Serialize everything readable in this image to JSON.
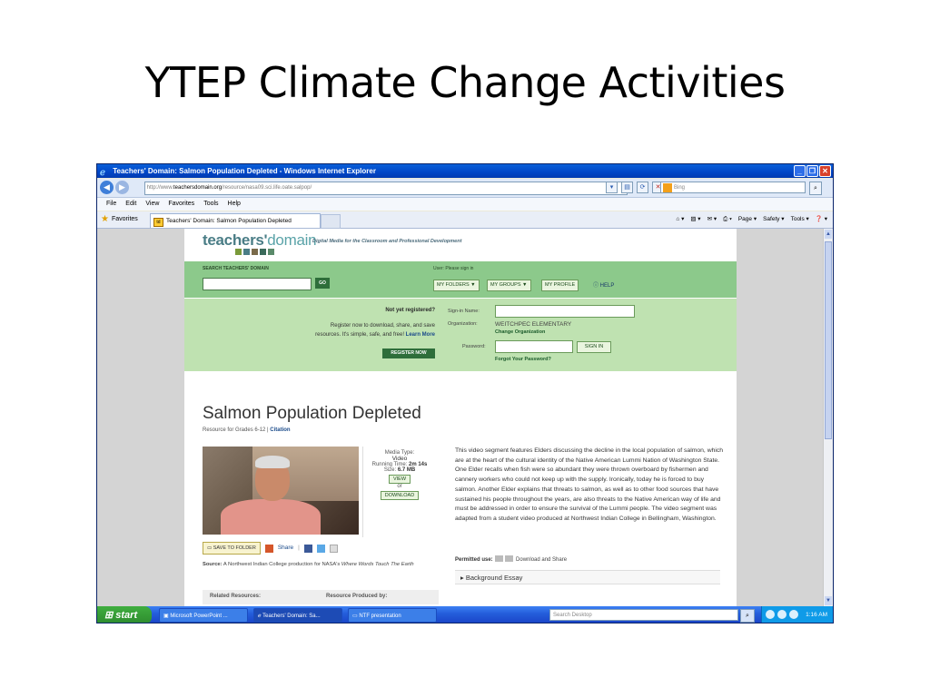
{
  "slide": {
    "title": "YTEP Climate Change Activities"
  },
  "browser": {
    "window_title": "Teachers' Domain: Salmon Population Depleted - Windows Internet Explorer",
    "address": {
      "prefix": "http://www.",
      "domain": "teachersdomain.org",
      "path": "/resource/nasa09.sci.life.oate.salpop/"
    },
    "search_placeholder": "Bing",
    "menu": [
      "File",
      "Edit",
      "View",
      "Favorites",
      "Tools",
      "Help"
    ],
    "favorites_label": "Favorites",
    "tab_label": "Teachers' Domain: Salmon Population Depleted",
    "command_bar": [
      "Page ▾",
      "Safety ▾",
      "Tools ▾"
    ]
  },
  "site": {
    "brand_teachers": "teachers'",
    "brand_domain": "domain",
    "tagline": "Digital Media for the Classroom and Professional Development",
    "brand_colors": [
      "#7a9a3a",
      "#4a7d86",
      "#7a6a4a",
      "#3a6a5a",
      "#5a8a6a"
    ],
    "search_label": "SEARCH TEACHERS' DOMAIN",
    "go_label": "GO",
    "user_label": "User: Please sign in",
    "nav_buttons": [
      "MY FOLDERS ▼",
      "MY GROUPS ▼",
      "MY PROFILE"
    ],
    "help_label": "HELP",
    "register": {
      "heading": "Not yet registered?",
      "line1": "Register now to download, share, and save",
      "line2": "resources. It's simple, safe, and free!",
      "learn_more": "Learn More",
      "button": "REGISTER NOW"
    },
    "signin": {
      "name_label": "Sign-in Name:",
      "org_label": "Organization:",
      "org_value": "WEITCHPEC ELEMENTARY",
      "change_org": "Change Organization",
      "password_label": "Password:",
      "signin_button": "SIGN IN",
      "forgot": "Forgot Your Password?"
    },
    "resource": {
      "title": "Salmon Population Depleted",
      "subtitle_prefix": "Resource for Grades 6-12 |",
      "citation": "Citation",
      "media_type_label": "Media Type:",
      "media_type": "Video",
      "running_time_label": "Running Time:",
      "running_time": "2m 14s",
      "size_label": "Size:",
      "size": "6.7 MB",
      "view_label": "VIEW",
      "or_label": "or",
      "download_label": "DOWNLOAD",
      "description": "This video segment features Elders discussing the decline in the local population of salmon, which are at the heart of the cultural identity of the Native American Lummi Nation of Washington State. One Elder recalls when fish were so abundant they were thrown overboard by fishermen and cannery workers who could not keep up with the supply. Ironically, today he is forced to buy salmon. Another Elder explains that threats to salmon, as well as to other food sources that have sustained his people throughout the years, are also threats to the Native American way of life and must be addressed in order to ensure the survival of the Lummi people. The video segment was adapted from a student video produced at Northwest Indian College in Bellingham, Washington.",
      "save_label": "SAVE TO FOLDER",
      "share_label": "Share",
      "source_label": "Source:",
      "source_text": "A Northwest Indian College production for NASA's",
      "source_title": "Where Words Touch The Earth",
      "permitted_label": "Permitted use:",
      "permitted_text": "Download and Share",
      "background_essay": "Background Essay",
      "related_label": "Related Resources:",
      "produced_label": "Resource Produced by:"
    }
  },
  "taskbar": {
    "start_label": "start",
    "items": [
      "Microsoft PowerPoint ...",
      "Teachers' Domain: Sa...",
      "NTF presentation"
    ],
    "search_placeholder": "Search Desktop",
    "clock": "1:16 AM"
  }
}
